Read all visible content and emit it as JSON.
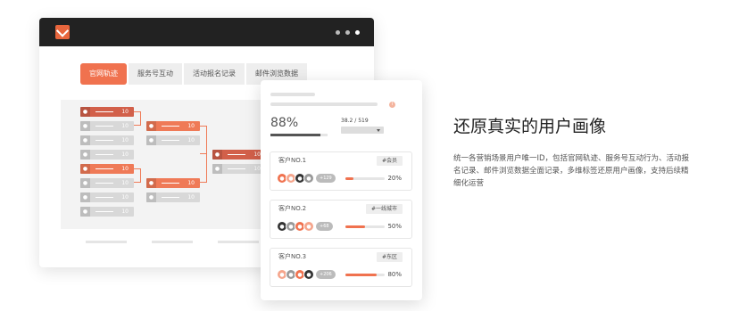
{
  "tabs": [
    {
      "label": "官网轨迹"
    },
    {
      "label": "服务号互动"
    },
    {
      "label": "活动报名记录"
    },
    {
      "label": "邮件浏览数据"
    }
  ],
  "tree": {
    "node_value": "10"
  },
  "card": {
    "percent": "88%",
    "percent_fill": 0.88,
    "ratio": "38.2 / 519",
    "customers": [
      {
        "name": "客户NO.1",
        "tag": "#会员",
        "more": "+129",
        "percent": "20%",
        "fill": 0.2
      },
      {
        "name": "客户NO.2",
        "tag": "#一线城市",
        "more": "+68",
        "percent": "50%",
        "fill": 0.5
      },
      {
        "name": "客户NO.3",
        "tag": "#东区",
        "more": "+206",
        "percent": "80%",
        "fill": 0.8
      }
    ]
  },
  "hero": {
    "title": "还原真实的用户画像",
    "description": "统一各营销场景用户唯一ID，包括官网轨迹、服务号互动行为、活动报名记录、邮件浏览数据全面记录，多维标签还原用户画像，支持后续精细化运营"
  },
  "colors": {
    "accent": "#f0724f",
    "dark": "#222222"
  }
}
